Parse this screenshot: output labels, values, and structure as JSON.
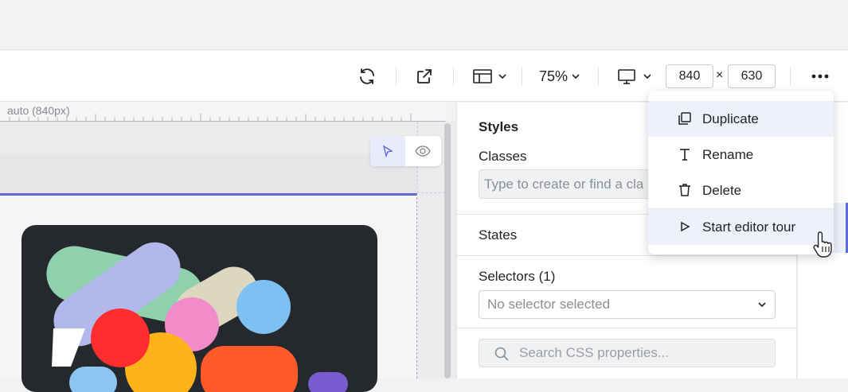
{
  "toolbar": {
    "zoom": "75%",
    "width_value": "840",
    "height_value": "630",
    "times": "×"
  },
  "canvas": {
    "ruler_label": "auto (840px)"
  },
  "styles_panel": {
    "title": "Styles",
    "classes_label": "Classes",
    "classes_placeholder": "Type to create or find a cla",
    "states_label": "States",
    "selectors_label": "Selectors (1)",
    "selector_value": "No selector selected",
    "search_placeholder": "Search CSS properties..."
  },
  "menu": {
    "items": [
      {
        "label": "Duplicate",
        "icon": "duplicate-icon"
      },
      {
        "label": "Rename",
        "icon": "text-icon"
      },
      {
        "label": "Delete",
        "icon": "trash-icon"
      },
      {
        "label": "Start editor tour",
        "icon": "play-icon"
      }
    ]
  },
  "colors": {
    "accent": "#5b6bd9",
    "art_bg": "#25282c"
  }
}
